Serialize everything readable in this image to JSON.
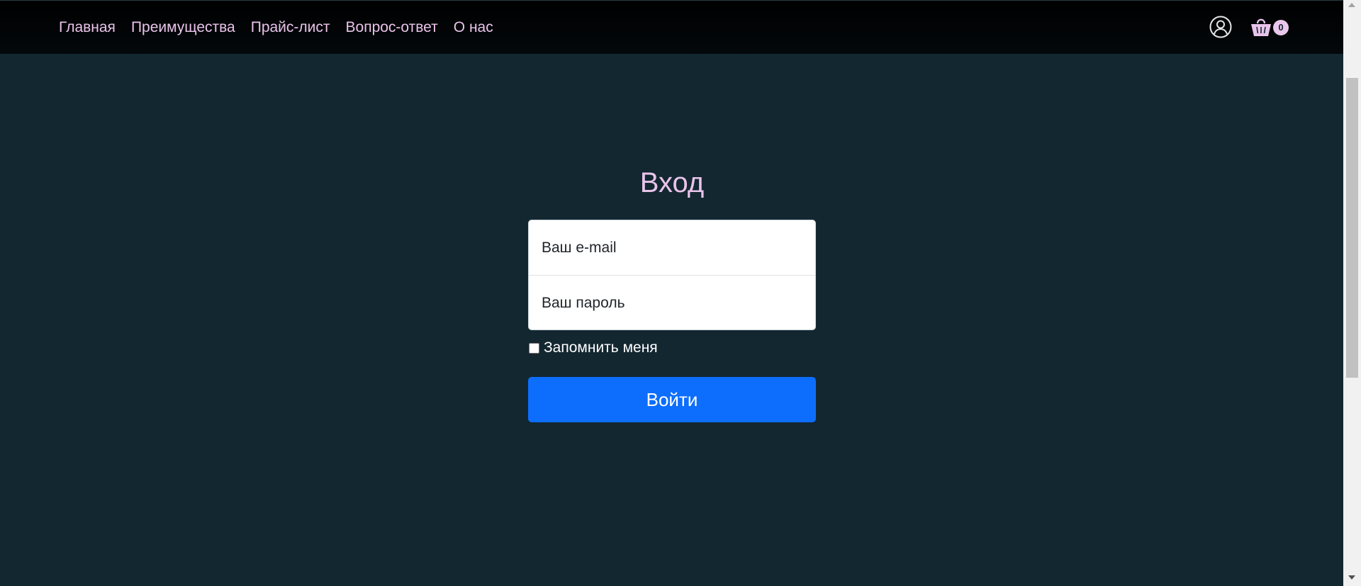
{
  "nav": {
    "items": [
      {
        "label": "Главная"
      },
      {
        "label": "Преимущества"
      },
      {
        "label": "Прайс-лист"
      },
      {
        "label": "Вопрос-ответ"
      },
      {
        "label": "О нас"
      }
    ],
    "account_icon": "user-circle-icon",
    "cart_icon": "shopping-basket-icon",
    "cart_count": "0"
  },
  "login": {
    "title": "Вход",
    "email_placeholder": "Ваш e-mail",
    "password_placeholder": "Ваш пароль",
    "remember_label": "Запомнить меня",
    "remember_checked": false,
    "submit_label": "Войти"
  },
  "colors": {
    "background": "#132731",
    "navbar": "#000000",
    "accent_pink": "#e8c3ea",
    "button_blue": "#0d6efd"
  }
}
